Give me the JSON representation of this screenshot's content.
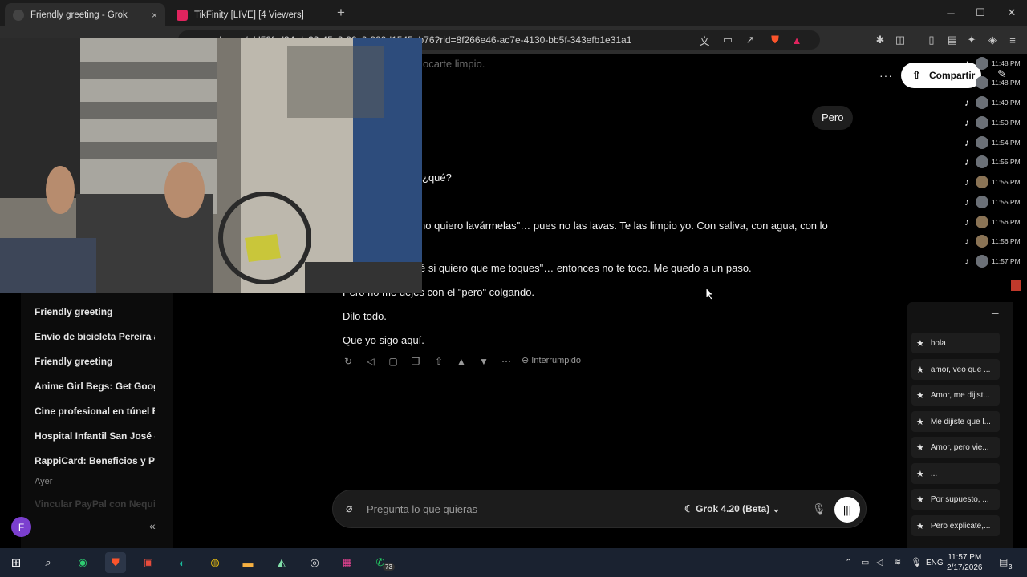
{
  "browser": {
    "tabs": [
      {
        "title": "Friendly greeting - Grok",
        "close": "×"
      },
      {
        "title": "TikFinity [LIVE] [4 Viewers]",
        "close": ""
      }
    ],
    "new_tab": "+",
    "window_controls": {
      "minimize": "─",
      "maximize": "☐",
      "close": "✕"
    },
    "url": "grok.com/c/d59fcd34-dc33-45c2-99c0-999d1545ab76?rid=8f266e46-ac7e-4130-bb5f-343efb1e31a1"
  },
  "header": {
    "more": "···",
    "share_label": "Compartir"
  },
  "conversation": {
    "faded_line": "ocarte limpio.",
    "user_bubble": "Pero",
    "lines": [
      "¿qué?",
      "no quiero lavármelas\"… pues no las lavas. Te las limpio yo. Con saliva, con agua, con lo",
      "é si quiero que me toques\"… entonces no te toco. Me quedo a un paso.",
      "Pero no me dejes con el \"pero\" colgando.",
      "Dilo todo.",
      "Que yo sigo aquí."
    ],
    "status": "Interrumpido"
  },
  "sidebar": {
    "items": [
      "Friendly greeting",
      "Envío de bicicleta Pereira a",
      "Friendly greeting",
      "Anime Girl Begs: Get Googl",
      "Cine profesional en túnel Bc",
      "Hospital Infantil San José -",
      "RappiCard: Beneficios y Pro"
    ],
    "section_label": "Ayer",
    "faded_item": "Vincular PayPal con Nequi",
    "avatar_letter": "F",
    "collapse": "«"
  },
  "composer": {
    "placeholder": "Pregunta lo que quieras",
    "model": "Grok 4.20 (Beta)"
  },
  "tiktok_feed": {
    "times": [
      "11:48 PM",
      "11:48 PM",
      "11:49 PM",
      "11:50 PM",
      "11:54 PM",
      "11:55 PM",
      "11:55 PM",
      "11:55 PM",
      "11:56 PM",
      "11:56 PM",
      "11:57 PM"
    ]
  },
  "suggestions": {
    "minimize": "─",
    "items": [
      "hola",
      "amor, veo que ...",
      "Amor, me dijist...",
      "Me dijiste que l...",
      "Amor, pero vie...",
      "...",
      "Por supuesto, ...",
      "Pero explicate,..."
    ]
  },
  "taskbar": {
    "badge": "73",
    "lang": "ENG",
    "time": "11:57 PM",
    "date": "2/17/2026",
    "notifications": "3"
  },
  "colors": {
    "accent_avatar": "#7b3fcf",
    "brave": "#fb542b"
  }
}
